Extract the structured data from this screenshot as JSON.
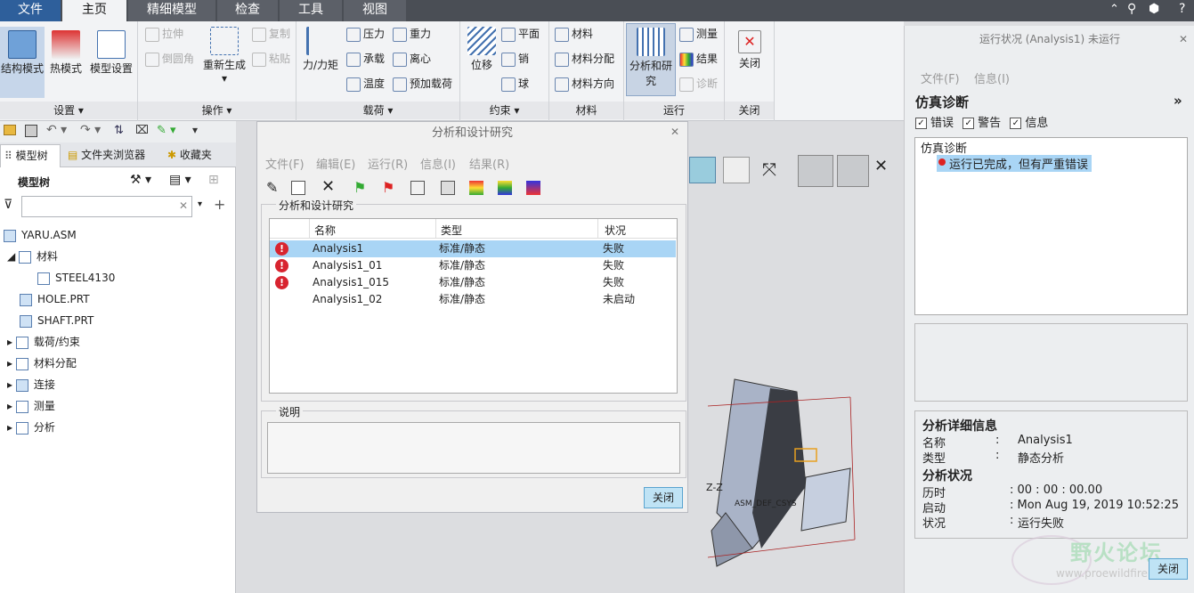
{
  "tabs": [
    "文件",
    "主页",
    "精细模型",
    "检查",
    "工具",
    "视图"
  ],
  "ribbon": {
    "settings": {
      "label": "设置",
      "btn1": "结构模式",
      "btn2": "热模式",
      "btn3": "模型设置"
    },
    "ops": {
      "label": "操作",
      "stretch": "拉伸",
      "fillet": "倒圆角",
      "regen": "重新生成",
      "copy": "复制",
      "paste": "粘贴"
    },
    "loads": {
      "label": "载荷",
      "force": "力/力矩",
      "pressure": "压力",
      "bearing": "承载",
      "temp": "温度",
      "gravity": "重力",
      "centrifugal": "离心",
      "preload": "预加载荷"
    },
    "constraints": {
      "label": "约束",
      "disp": "位移",
      "plane": "平面",
      "pin": "销",
      "ball": "球"
    },
    "material": {
      "label": "材料",
      "mat": "材料",
      "assign": "材料分配",
      "dir": "材料方向"
    },
    "run": {
      "label": "运行",
      "analysis": "分析和研究",
      "measure": "测量",
      "results": "结果",
      "diag": "诊断"
    },
    "close": {
      "label": "关闭",
      "btn": "关闭"
    }
  },
  "left": {
    "tabs": [
      "模型树",
      "文件夹浏览器",
      "收藏夹"
    ],
    "tree_title": "模型树",
    "items": [
      "YARU.ASM",
      "材料",
      "STEEL4130",
      "HOLE.PRT",
      "SHAFT.PRT",
      "载荷/约束",
      "材料分配",
      "连接",
      "测量",
      "分析"
    ]
  },
  "dialog": {
    "title": "分析和设计研究",
    "menus": [
      "文件(F)",
      "编辑(E)",
      "运行(R)",
      "信息(I)",
      "结果(R)"
    ],
    "section": "分析和设计研究",
    "cols": [
      "名称",
      "类型",
      "状况"
    ],
    "rows": [
      {
        "name": "Analysis1",
        "type": "标准/静态",
        "status": "失败"
      },
      {
        "name": "Analysis1_01",
        "type": "标准/静态",
        "status": "失败"
      },
      {
        "name": "Analysis1_015",
        "type": "标准/静态",
        "status": "失败"
      },
      {
        "name": "Analysis1_02",
        "type": "标准/静态",
        "status": "未启动"
      }
    ],
    "desc_label": "说明",
    "close_btn": "关闭"
  },
  "right": {
    "title": "运行状况 (Analysis1) 未运行",
    "menus": [
      "文件(F)",
      "信息(I)"
    ],
    "diag_title": "仿真诊断",
    "checks": [
      "错误",
      "警告",
      "信息"
    ],
    "diag_root": "仿真诊断",
    "diag_msg": "运行已完成，但有严重错误",
    "details_title": "分析详细信息",
    "name_label": "名称",
    "name_val": "Analysis1",
    "type_label": "类型",
    "type_val": "静态分析",
    "status_title": "分析状况",
    "elapsed_label": "历时",
    "elapsed_val": ": 00 : 00 : 00.00",
    "start_label": "启动",
    "start_val": ": Mon Aug 19, 2019   10:52:25",
    "state_label": "状况",
    "state_val": "运行失败",
    "close_btn": "关闭"
  },
  "watermark": {
    "text": "野火论坛",
    "url": "www.proewildfire.cn"
  },
  "gfx": {
    "axis_label": "Z-Z",
    "csys_label": "ASM_DEF_CSYS"
  }
}
